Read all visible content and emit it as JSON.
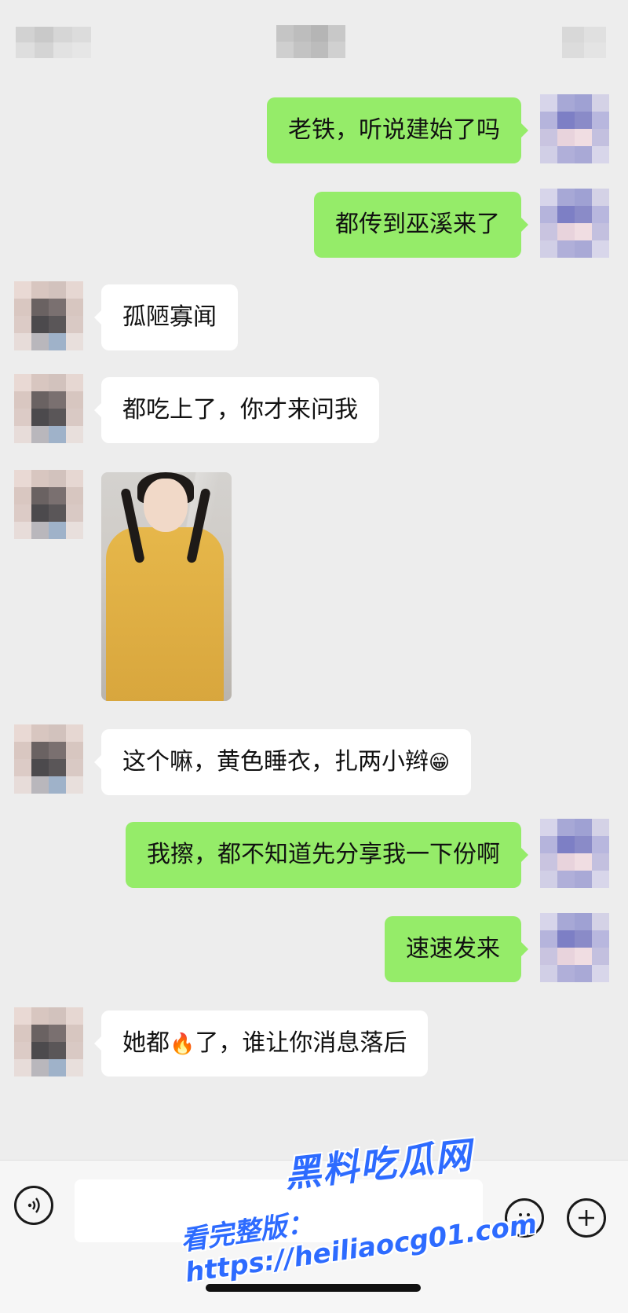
{
  "messages": [
    {
      "dir": "out",
      "text": "老铁，听说建始了吗"
    },
    {
      "dir": "out",
      "text": "都传到巫溪来了"
    },
    {
      "dir": "in",
      "text": "孤陋寡闻"
    },
    {
      "dir": "in",
      "text": "都吃上了，你才来问我"
    },
    {
      "dir": "in",
      "type": "image"
    },
    {
      "dir": "in",
      "text": "这个嘛，黄色睡衣，扎两小辫",
      "emoji": "😁"
    },
    {
      "dir": "out",
      "text": "我擦，都不知道先分享我一下份啊"
    },
    {
      "dir": "out",
      "text": "速速发来"
    },
    {
      "dir": "in",
      "text_before": "她都",
      "emoji": "🔥",
      "text_after": "了，谁让你消息落后"
    }
  ],
  "watermark": {
    "title": "黑料吃瓜网",
    "url": "看完整版：https://heiliaocg01.com"
  },
  "icons": {
    "voice": "voice-icon",
    "emoji": "emoji-icon",
    "plus": "plus-icon"
  },
  "colors": {
    "outgoing_bubble": "#95ec69",
    "incoming_bubble": "#ffffff",
    "background": "#ededed",
    "watermark": "#2d6bff"
  }
}
